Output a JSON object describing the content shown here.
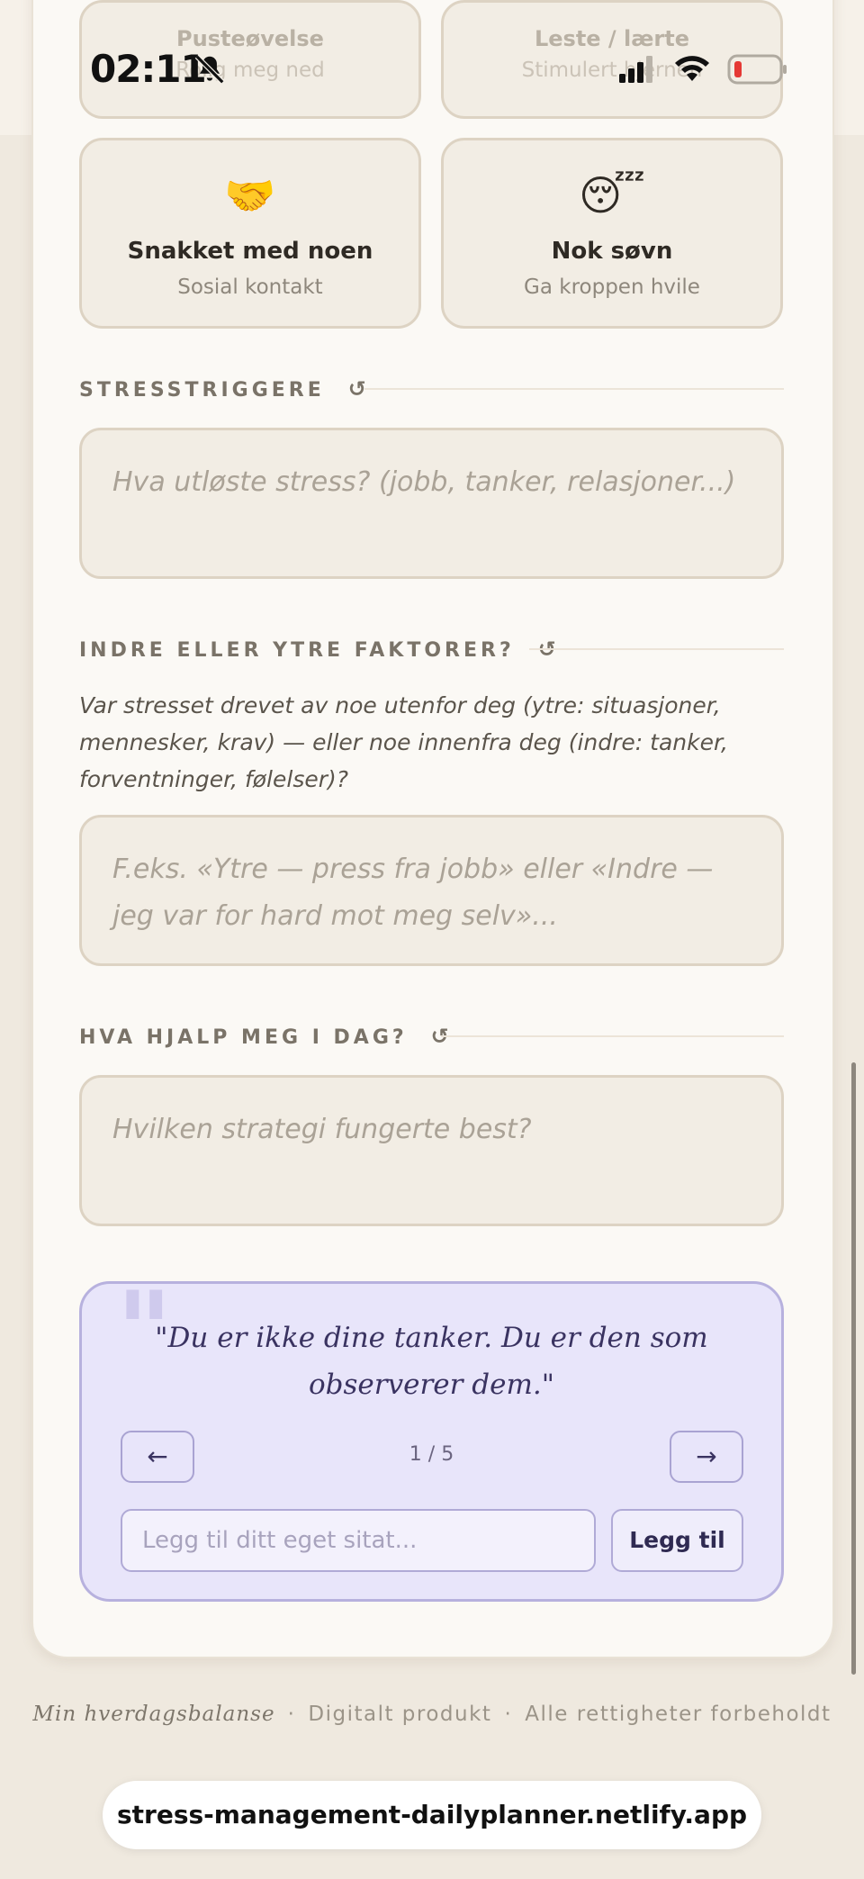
{
  "status_bar": {
    "time": "02:11"
  },
  "top_tiles": [
    {
      "title": "Pusteøvelse",
      "subtitle": "Rolig meg ned"
    },
    {
      "title": "Leste / lærte",
      "subtitle": "Stimulert hjernen"
    }
  ],
  "tiles": [
    {
      "emoji": "🤝",
      "title": "Snakket med noen",
      "subtitle": "Sosial kontakt"
    },
    {
      "emoji": "😴",
      "title": "Nok søvn",
      "subtitle": "Ga kroppen hvile"
    }
  ],
  "sections": {
    "triggers": {
      "title": "STRESSTRIGGERE",
      "placeholder": "Hva utløste stress? (jobb, tanker, relasjoner...)"
    },
    "factors": {
      "title": "INDRE ELLER YTRE FAKTORER?",
      "description": "Var stresset drevet av noe utenfor deg (ytre: situasjoner, mennesker, krav) — eller noe innenfra deg (indre: tanker, forventninger, følelser)?",
      "placeholder": "F.eks. «Ytre — press fra jobb» eller «Indre — jeg var for hard mot meg selv»..."
    },
    "helped": {
      "title": "HVA HJALP MEG I DAG?",
      "placeholder": "Hvilken strategi fungerte best?"
    }
  },
  "quote": {
    "text": "\"Du er ikke dine tanker. Du er den som observerer dem.\"",
    "prev": "←",
    "next": "→",
    "counter": "1 / 5",
    "input_placeholder": "Legg til ditt eget sitat...",
    "add_label": "Legg til"
  },
  "footer": {
    "brand": "Min hverdagsbalanse",
    "sep": "·",
    "product": "Digitalt produkt",
    "rights": "Alle rettigheter forbeholdt"
  },
  "browser": {
    "url": "stress-management-dailyplanner.netlify.app"
  },
  "icons": {
    "reset": "↺",
    "mute": "bell-slash",
    "signal": "cellular-bars",
    "wifi": "wifi",
    "battery": "battery-low"
  },
  "colors": {
    "accent_lilac": "#e8e5fa",
    "tile_bg": "#f2ede4",
    "battery_low": "#e53935"
  }
}
